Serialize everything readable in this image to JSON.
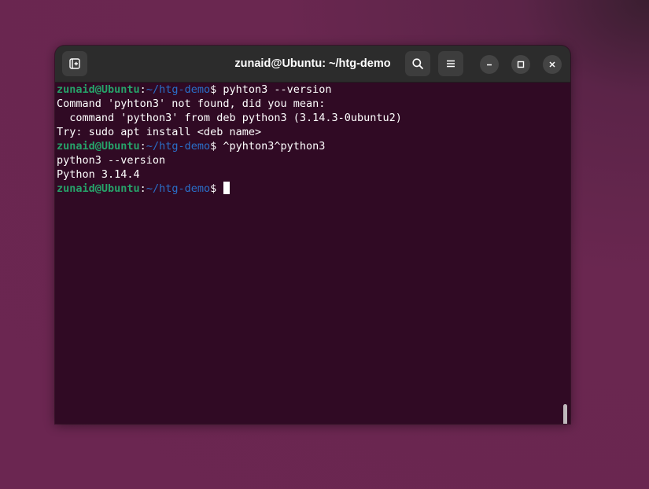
{
  "window": {
    "title": "zunaid@Ubuntu: ~/htg-demo"
  },
  "icons": {
    "new_tab": "new-tab-icon",
    "search": "search-icon",
    "menu": "hamburger-menu-icon",
    "minimize": "minimize-icon",
    "maximize": "maximize-icon",
    "close": "close-icon"
  },
  "colors": {
    "terminal_bg": "#300a24",
    "prompt_user": "#26a269",
    "prompt_path": "#2a6fc9",
    "text": "#ffffff",
    "desktop_bg": "#6b2651"
  },
  "prompt": {
    "user_host": "zunaid@Ubuntu",
    "separator": ":",
    "path": "~/htg-demo",
    "symbol": "$ "
  },
  "terminal": {
    "cmd1": "pyhton3 --version",
    "out1": "Command 'pyhton3' not found, did you mean:",
    "out2": "  command 'python3' from deb python3 (3.14.3-0ubuntu2)",
    "out3": "Try: sudo apt install <deb name>",
    "cmd2": "^pyhton3^python3",
    "out4": "python3 --version",
    "out5": "Python 3.14.4",
    "cmd3": ""
  }
}
